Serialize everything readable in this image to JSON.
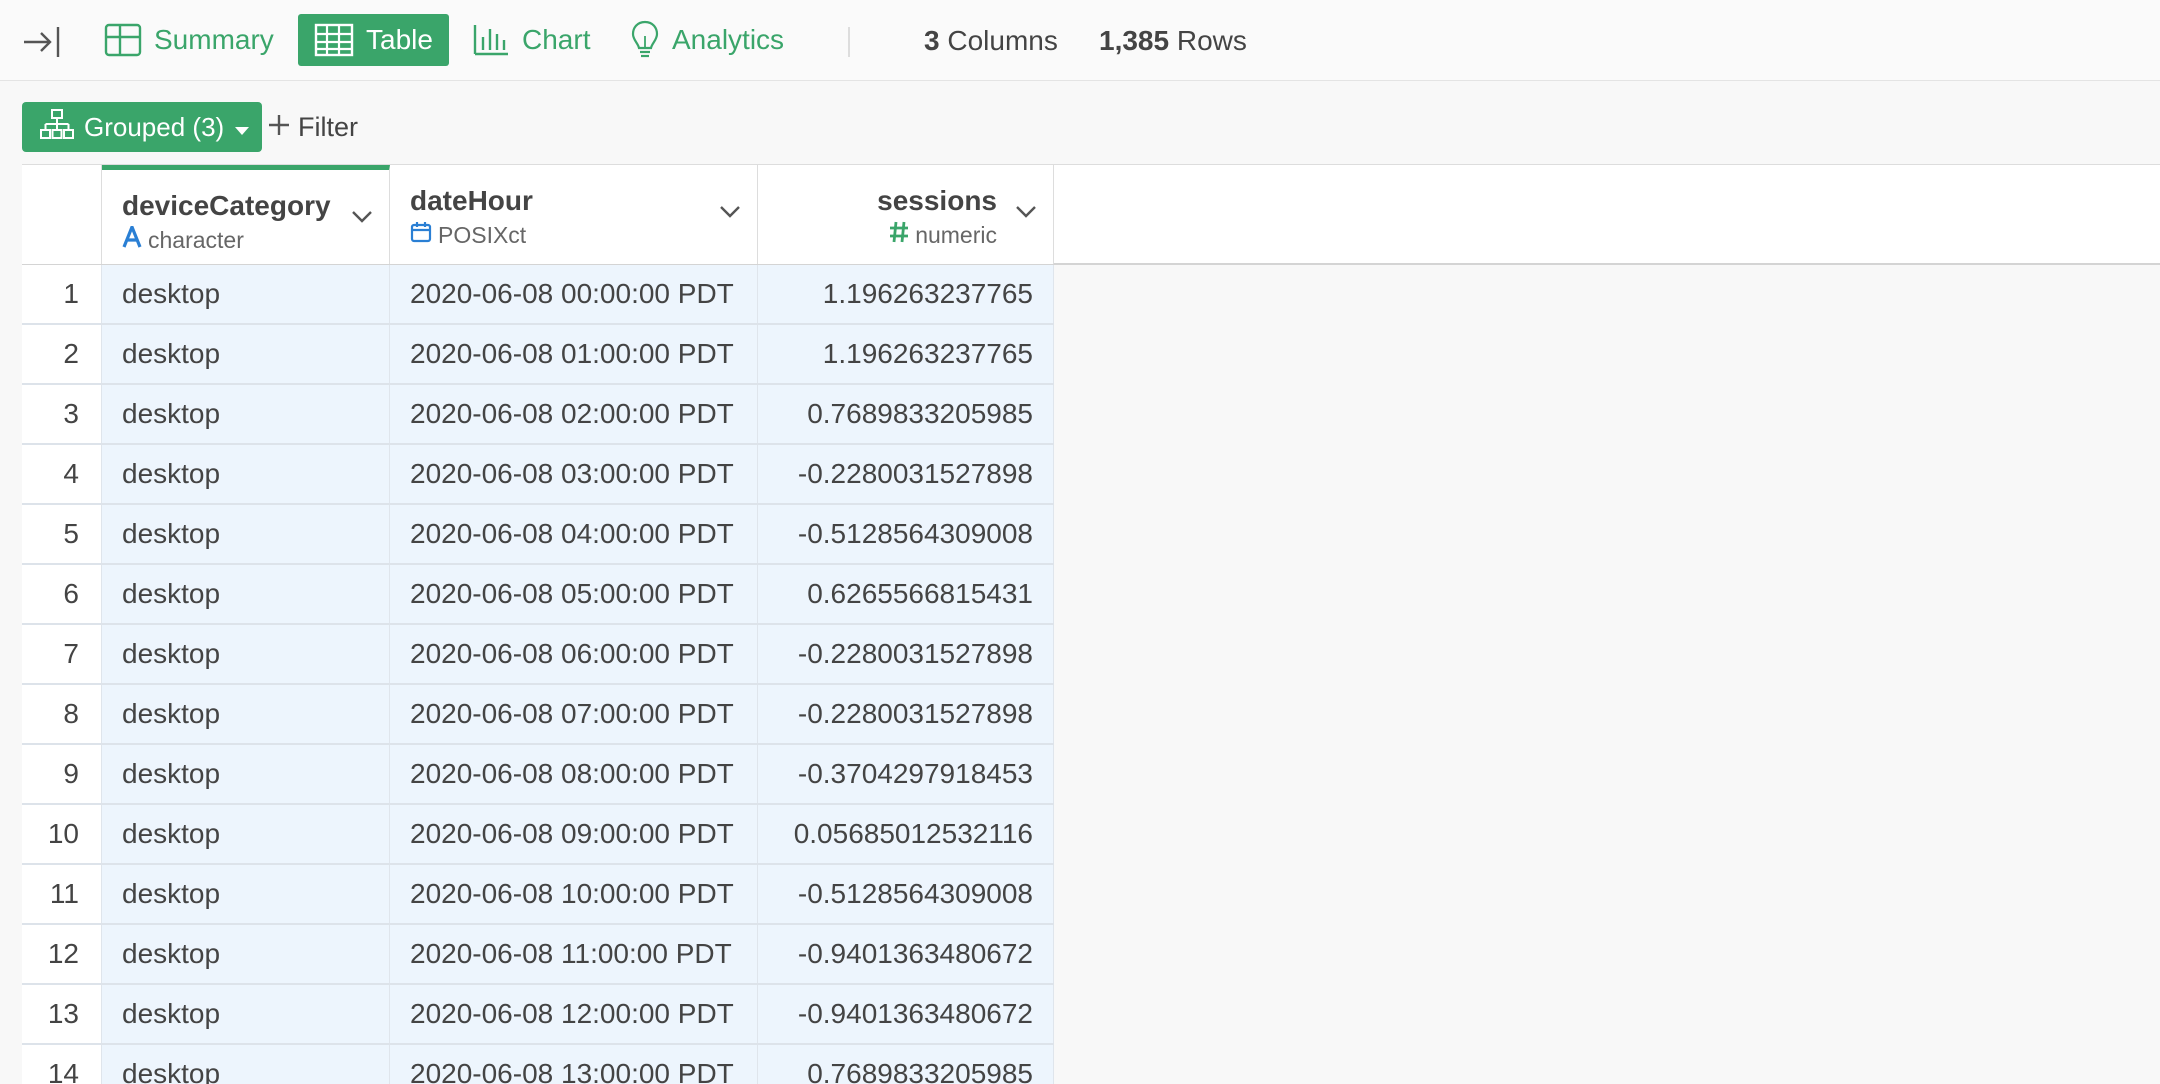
{
  "toolbar": {
    "tabs": [
      {
        "label": "Summary",
        "icon": "summary-grid-icon",
        "active": false
      },
      {
        "label": "Table",
        "icon": "table-icon",
        "active": true
      },
      {
        "label": "Chart",
        "icon": "bar-chart-icon",
        "active": false
      },
      {
        "label": "Analytics",
        "icon": "lightbulb-icon",
        "active": false
      }
    ],
    "columns_count": "3",
    "columns_label": "Columns",
    "rows_count": "1,385",
    "rows_label": "Rows"
  },
  "actions": {
    "grouped_label": "Grouped (3)",
    "filter_label": "Filter"
  },
  "colors": {
    "accent": "#3aa56a",
    "character_type": "#2a7fd4",
    "numeric_type": "#3aa56a",
    "cell_bg": "#edf5fd"
  },
  "table": {
    "columns": [
      {
        "name": "deviceCategory",
        "type": "character",
        "type_icon": "character-type-icon"
      },
      {
        "name": "dateHour",
        "type": "POSIXct",
        "type_icon": "calendar-icon"
      },
      {
        "name": "sessions",
        "type": "numeric",
        "type_icon": "hash-icon"
      }
    ],
    "rows": [
      {
        "idx": "1",
        "deviceCategory": "desktop",
        "dateHour": "2020-06-08 00:00:00 PDT",
        "sessions": "1.196263237765"
      },
      {
        "idx": "2",
        "deviceCategory": "desktop",
        "dateHour": "2020-06-08 01:00:00 PDT",
        "sessions": "1.196263237765"
      },
      {
        "idx": "3",
        "deviceCategory": "desktop",
        "dateHour": "2020-06-08 02:00:00 PDT",
        "sessions": "0.7689833205985"
      },
      {
        "idx": "4",
        "deviceCategory": "desktop",
        "dateHour": "2020-06-08 03:00:00 PDT",
        "sessions": "-0.2280031527898"
      },
      {
        "idx": "5",
        "deviceCategory": "desktop",
        "dateHour": "2020-06-08 04:00:00 PDT",
        "sessions": "-0.5128564309008"
      },
      {
        "idx": "6",
        "deviceCategory": "desktop",
        "dateHour": "2020-06-08 05:00:00 PDT",
        "sessions": "0.6265566815431"
      },
      {
        "idx": "7",
        "deviceCategory": "desktop",
        "dateHour": "2020-06-08 06:00:00 PDT",
        "sessions": "-0.2280031527898"
      },
      {
        "idx": "8",
        "deviceCategory": "desktop",
        "dateHour": "2020-06-08 07:00:00 PDT",
        "sessions": "-0.2280031527898"
      },
      {
        "idx": "9",
        "deviceCategory": "desktop",
        "dateHour": "2020-06-08 08:00:00 PDT",
        "sessions": "-0.3704297918453"
      },
      {
        "idx": "10",
        "deviceCategory": "desktop",
        "dateHour": "2020-06-08 09:00:00 PDT",
        "sessions": "0.05685012532116"
      },
      {
        "idx": "11",
        "deviceCategory": "desktop",
        "dateHour": "2020-06-08 10:00:00 PDT",
        "sessions": "-0.5128564309008"
      },
      {
        "idx": "12",
        "deviceCategory": "desktop",
        "dateHour": "2020-06-08 11:00:00 PDT",
        "sessions": "-0.9401363480672"
      },
      {
        "idx": "13",
        "deviceCategory": "desktop",
        "dateHour": "2020-06-08 12:00:00 PDT",
        "sessions": "-0.9401363480672"
      },
      {
        "idx": "14",
        "deviceCategory": "desktop",
        "dateHour": "2020-06-08 13:00:00 PDT",
        "sessions": "0.7689833205985"
      }
    ]
  }
}
